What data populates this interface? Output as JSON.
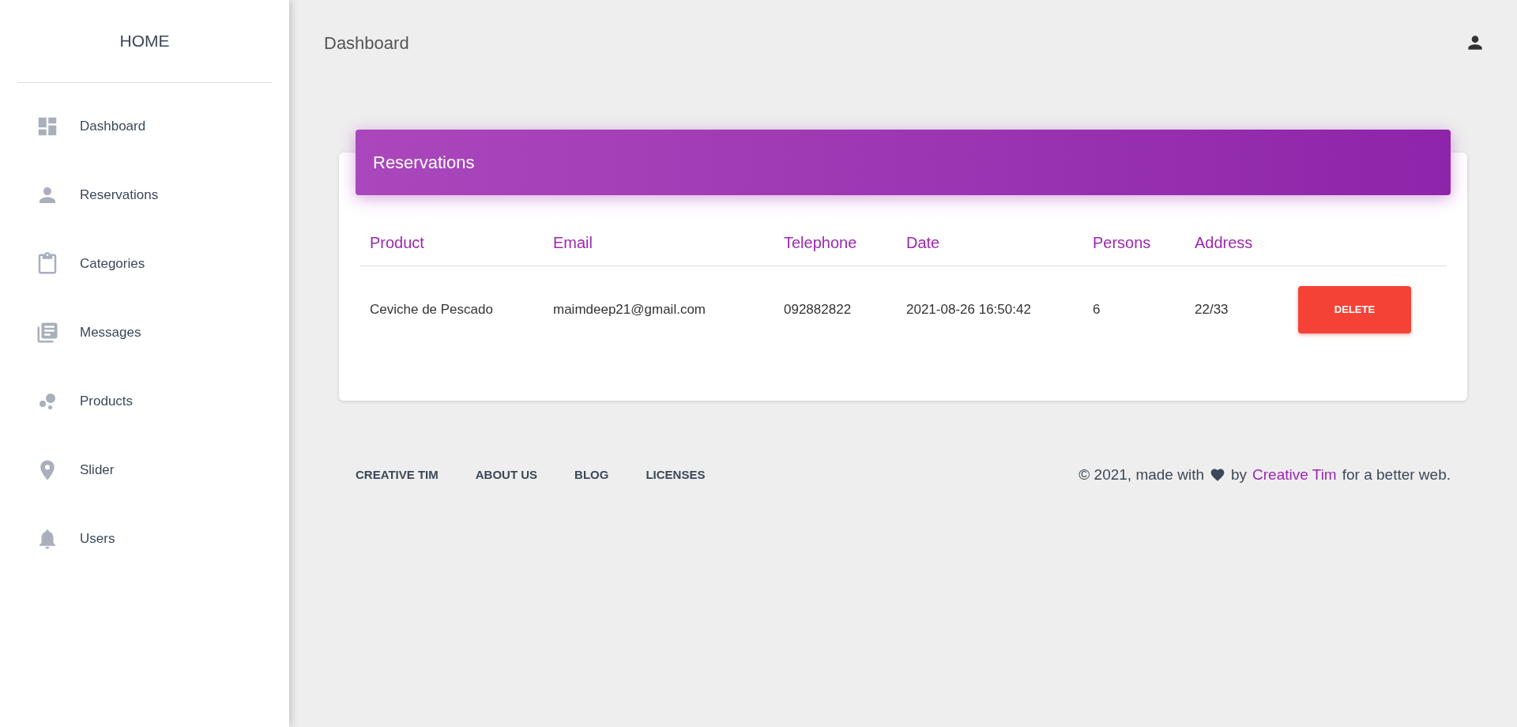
{
  "sidebar": {
    "title": "HOME",
    "items": [
      {
        "label": "Dashboard"
      },
      {
        "label": "Reservations"
      },
      {
        "label": "Categories"
      },
      {
        "label": "Messages"
      },
      {
        "label": "Products"
      },
      {
        "label": "Slider"
      },
      {
        "label": "Users"
      }
    ]
  },
  "topbar": {
    "title": "Dashboard"
  },
  "card": {
    "title": "Reservations",
    "table": {
      "columns": [
        "Product",
        "Email",
        "Telephone",
        "Date",
        "Persons",
        "Address"
      ],
      "rows": [
        {
          "cells": [
            "Ceviche de Pescado",
            "maimdeep21@gmail.com",
            "092882822",
            "2021-08-26 16:50:42",
            "6",
            "22/33"
          ],
          "action": "DELETE"
        }
      ]
    }
  },
  "footer": {
    "links": [
      "CREATIVE TIM",
      "ABOUT US",
      "BLOG",
      "LICENSES"
    ],
    "credit": {
      "prefix": "© 2021, made with",
      "middle": "by",
      "link": "Creative Tim",
      "suffix": "for a better web."
    }
  }
}
